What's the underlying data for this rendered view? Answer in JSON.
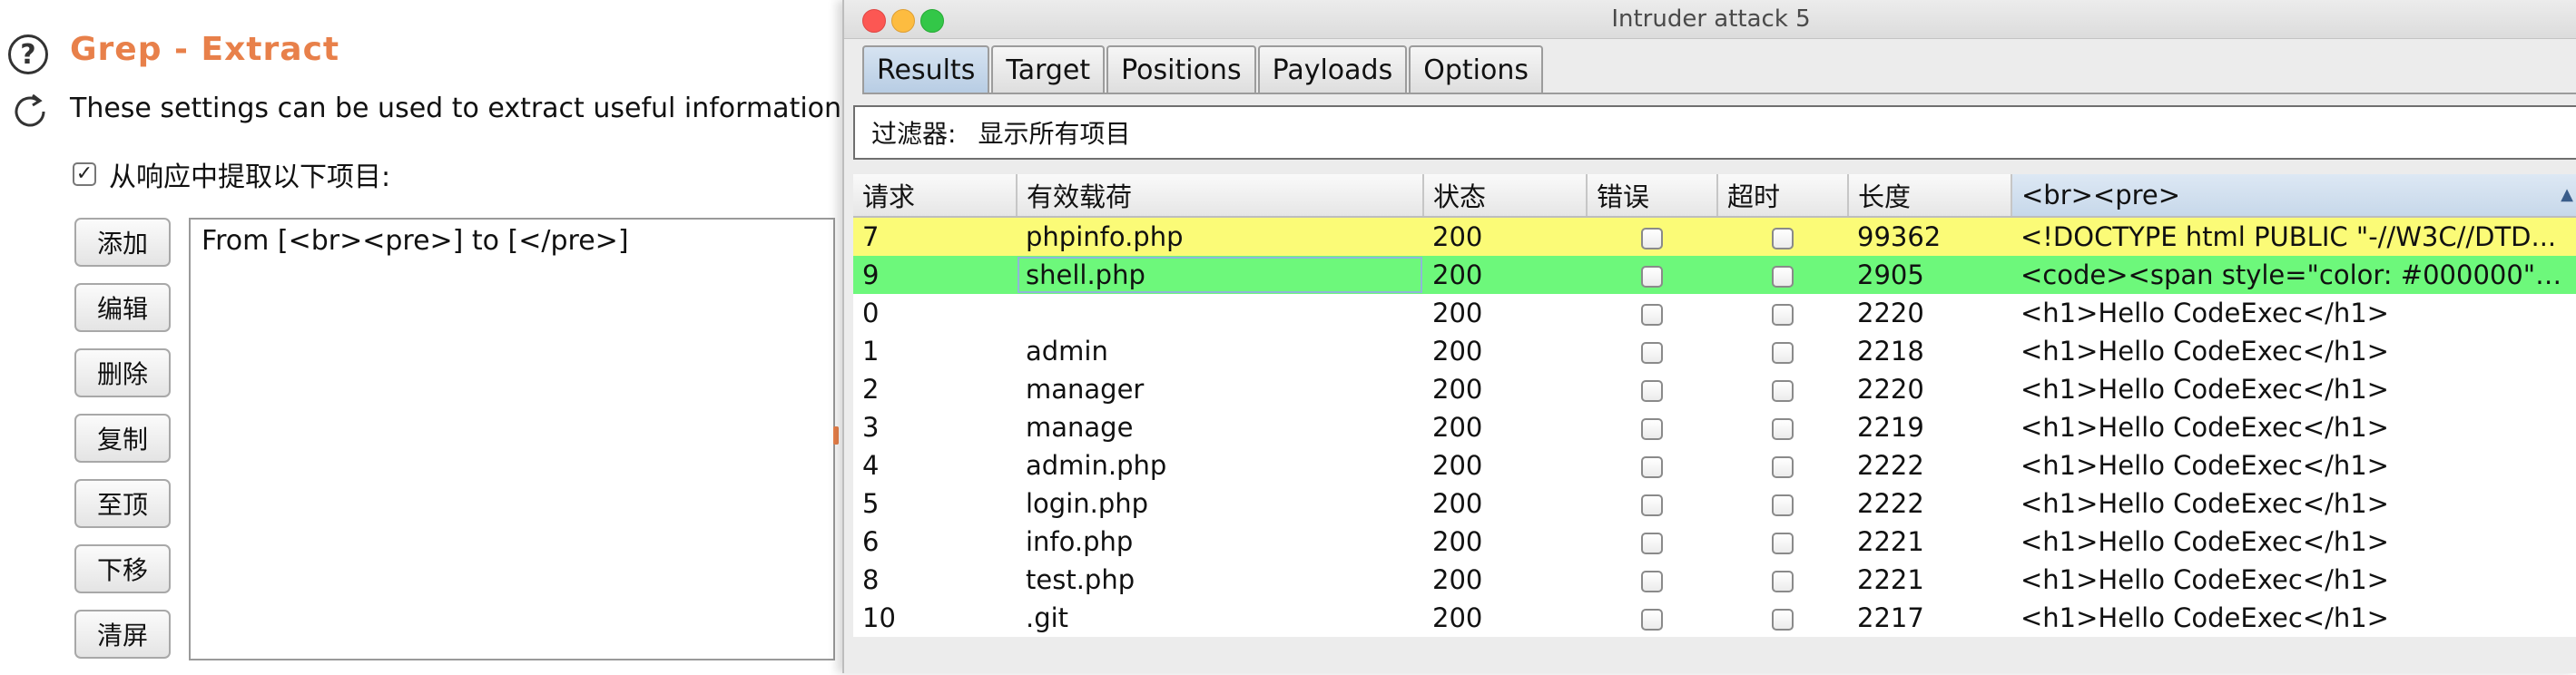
{
  "settings": {
    "title": "Grep - Extract",
    "description": "These settings can be used to extract useful information fr",
    "extract_checkbox_label": "从响应中提取以下项目:",
    "extract_checked": true,
    "buttons": [
      "添加",
      "编辑",
      "删除",
      "复制",
      "至顶",
      "下移",
      "清屏"
    ],
    "rules": [
      "From [<br><pre>] to [</pre>]"
    ],
    "icons": [
      "help-icon",
      "refresh-icon"
    ]
  },
  "window": {
    "title": "Intruder attack 5",
    "tabs": [
      "Results",
      "Target",
      "Positions",
      "Payloads",
      "Options"
    ],
    "active_tab": "Results"
  },
  "filter": {
    "label": "过滤器:",
    "value": "显示所有项目"
  },
  "table": {
    "columns": [
      "请求",
      "有效载荷",
      "状态",
      "错误",
      "超时",
      "长度",
      "<br><pre>"
    ],
    "sorted_column": "<br><pre>",
    "rows": [
      {
        "request": "7",
        "payload": "phpinfo.php",
        "status": "200",
        "error": false,
        "timeout": false,
        "length": "99362",
        "extract": "<!DOCTYPE html PUBLIC \"-//W3C//DTD...",
        "highlight": "yellow"
      },
      {
        "request": "9",
        "payload": "shell.php",
        "status": "200",
        "error": false,
        "timeout": false,
        "length": "2905",
        "extract": "<code><span style=\"color: #000000\">...",
        "highlight": "green"
      },
      {
        "request": "0",
        "payload": "",
        "status": "200",
        "error": false,
        "timeout": false,
        "length": "2220",
        "extract": "<h1>Hello CodeExec</h1>",
        "highlight": ""
      },
      {
        "request": "1",
        "payload": "admin",
        "status": "200",
        "error": false,
        "timeout": false,
        "length": "2218",
        "extract": "<h1>Hello CodeExec</h1>",
        "highlight": ""
      },
      {
        "request": "2",
        "payload": "manager",
        "status": "200",
        "error": false,
        "timeout": false,
        "length": "2220",
        "extract": "<h1>Hello CodeExec</h1>",
        "highlight": ""
      },
      {
        "request": "3",
        "payload": "manage",
        "status": "200",
        "error": false,
        "timeout": false,
        "length": "2219",
        "extract": "<h1>Hello CodeExec</h1>",
        "highlight": ""
      },
      {
        "request": "4",
        "payload": "admin.php",
        "status": "200",
        "error": false,
        "timeout": false,
        "length": "2222",
        "extract": "<h1>Hello CodeExec</h1>",
        "highlight": ""
      },
      {
        "request": "5",
        "payload": "login.php",
        "status": "200",
        "error": false,
        "timeout": false,
        "length": "2222",
        "extract": "<h1>Hello CodeExec</h1>",
        "highlight": ""
      },
      {
        "request": "6",
        "payload": "info.php",
        "status": "200",
        "error": false,
        "timeout": false,
        "length": "2221",
        "extract": "<h1>Hello CodeExec</h1>",
        "highlight": ""
      },
      {
        "request": "8",
        "payload": "test.php",
        "status": "200",
        "error": false,
        "timeout": false,
        "length": "2221",
        "extract": "<h1>Hello CodeExec</h1>",
        "highlight": ""
      },
      {
        "request": "10",
        "payload": ".git",
        "status": "200",
        "error": false,
        "timeout": false,
        "length": "2217",
        "extract": "<h1>Hello CodeExec</h1>",
        "highlight": ""
      }
    ]
  },
  "colors": {
    "title_accent": "#e8804a",
    "highlight_yellow": "#fbfb77",
    "highlight_green": "#6df87b",
    "active_tab": "#c7d8ea"
  }
}
